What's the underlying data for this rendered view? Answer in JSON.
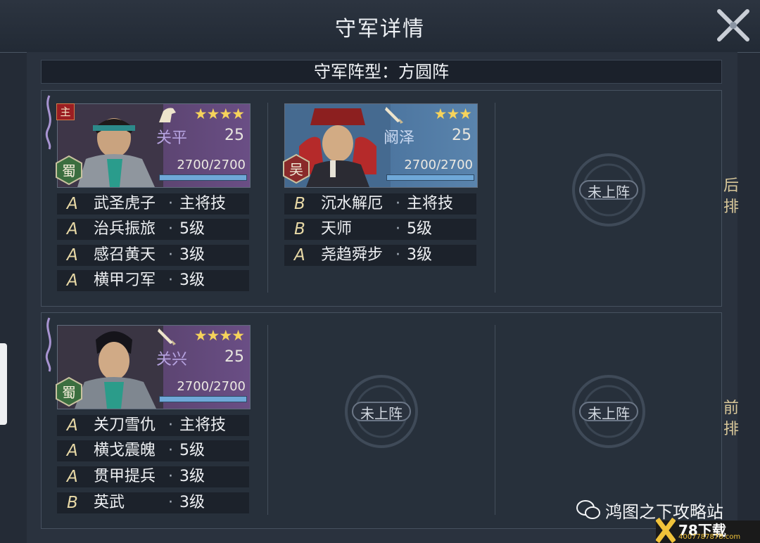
{
  "header": {
    "title": "守军详情"
  },
  "formation": {
    "text": "守军阵型：方圆阵"
  },
  "rows": {
    "back_label": "后排",
    "front_label": "前排"
  },
  "generals": [
    {
      "name": "关平",
      "level": "25",
      "stars": "★★★★",
      "hp": "2700/2700",
      "faction": "蜀",
      "lord_badge": "主",
      "hp_fraction": 1.0,
      "skills": [
        {
          "grade": "A",
          "name": "武圣虎子",
          "level": "主将技"
        },
        {
          "grade": "A",
          "name": "治兵振旅",
          "level": "5级"
        },
        {
          "grade": "A",
          "name": "感召黄天",
          "level": "3级"
        },
        {
          "grade": "A",
          "name": "横甲刁军",
          "level": "3级"
        }
      ]
    },
    {
      "name": "阚泽",
      "level": "25",
      "stars": "★★★",
      "hp": "2700/2700",
      "faction": "吴",
      "hp_fraction": 1.0,
      "skills": [
        {
          "grade": "B",
          "name": "沉水解厄",
          "level": "主将技"
        },
        {
          "grade": "B",
          "name": "天师",
          "level": "5级"
        },
        {
          "grade": "A",
          "name": "尧趋舜步",
          "level": "3级"
        }
      ]
    },
    {
      "name": "关兴",
      "level": "25",
      "stars": "★★★★",
      "hp": "2700/2700",
      "faction": "蜀",
      "hp_fraction": 1.0,
      "skills": [
        {
          "grade": "A",
          "name": "关刀雪仇",
          "level": "主将技"
        },
        {
          "grade": "A",
          "name": "横戈震魄",
          "level": "5级"
        },
        {
          "grade": "A",
          "name": "贯甲提兵",
          "level": "3级"
        },
        {
          "grade": "B",
          "name": "英武",
          "level": "3级"
        }
      ]
    }
  ],
  "empty_slot_label": "未上阵",
  "skill_separator": "·",
  "watermark": {
    "text": "鸿图之下攻略站"
  },
  "site_logo": {
    "name": "78下载",
    "url_text": "4007787878.com"
  },
  "colors": {
    "stars": "#f6d35b",
    "shu_faction": "#3b6e3f",
    "wu_faction": "#8a2a2a",
    "accent_gold": "#d9c89a"
  },
  "icons": {
    "close": "close-x-icon",
    "weapon": "weapon-icon",
    "horse": "horse-icon",
    "wechat": "wechat-icon"
  }
}
